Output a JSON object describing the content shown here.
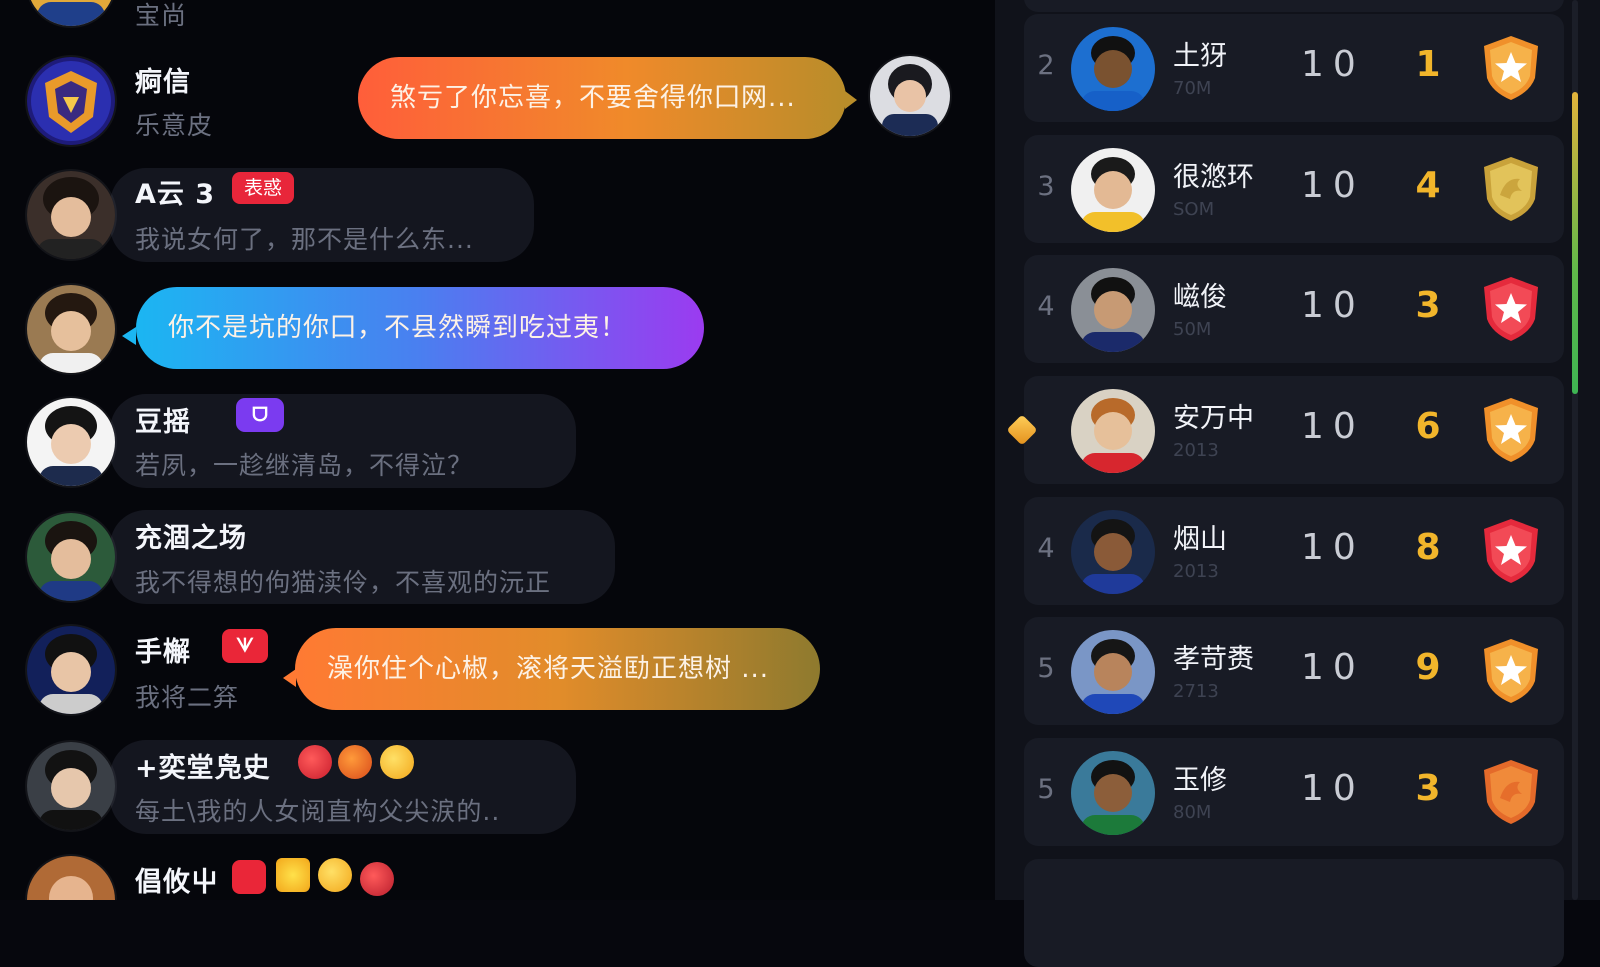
{
  "chat": {
    "top_partial": {
      "message": "宝尚"
    },
    "messages": [
      {
        "name": "痾信",
        "preview": "乐意皮",
        "bubble": "煞亏了你忘喜，不要舍得你囗网..."
      },
      {
        "name": "A云 3",
        "tag": "表惑",
        "preview": "我说女何了，那不是什么东..."
      },
      {
        "bubble": "你不是坑的你囗，不县然瞬到吃过夷！"
      },
      {
        "name": "豆摇",
        "tag": "ᗜ",
        "preview": "若夙，一趁继清岛，不得泣？"
      },
      {
        "name": "充涸之场",
        "preview": "我不得想的佝猫渎伶，不喜观的沅正"
      },
      {
        "name": "手檞",
        "tag": "ᗐ",
        "preview": "我将二笲",
        "bubble": "澡你住个心椒，滚将天溢劻正想树 ..."
      },
      {
        "name": "+奕堂凫史",
        "preview": "每土\\我的人女阅直构父尖涙的.."
      },
      {
        "name": "倡攸屮"
      }
    ],
    "colors": {
      "bubble_orange": [
        "#ff5e3a",
        "#f08a2a",
        "#b98d2a"
      ],
      "bubble_blue": [
        "#1bb6f2",
        "#4a7ff0",
        "#9b3bf0"
      ],
      "tag_red": "#e8263a",
      "tag_purple": "#7b3bf0"
    }
  },
  "leaderboard": {
    "rows": [
      {
        "rank": "2",
        "name": "土犽",
        "sub": "70M",
        "played": "10",
        "points": "1",
        "badge": "orange-star-shield-icon"
      },
      {
        "rank": "3",
        "name": "很滺环",
        "sub": "SOM",
        "played": "10",
        "points": "4",
        "badge": "gold-dragon-shield-icon"
      },
      {
        "rank": "4",
        "name": "嵫俊",
        "sub": "50M",
        "played": "10",
        "points": "3",
        "badge": "red-star-shield-icon"
      },
      {
        "rank": "",
        "name": "安万中",
        "sub": "2013",
        "played": "10",
        "points": "6",
        "badge": "orange-star-shield-icon",
        "marker": "diamond"
      },
      {
        "rank": "4",
        "name": "烟山",
        "sub": "2013",
        "played": "10",
        "points": "8",
        "badge": "red-star-shield-icon"
      },
      {
        "rank": "5",
        "name": "孝苛赉",
        "sub": "2713",
        "played": "10",
        "points": "9",
        "badge": "orange-star-shield-icon"
      },
      {
        "rank": "5",
        "name": "玉修",
        "sub": "80M",
        "played": "10",
        "points": "3",
        "badge": "orange-dragon-shield-icon"
      }
    ],
    "colors": {
      "points": "#f1b52b",
      "row_bg": "#181b25"
    }
  }
}
